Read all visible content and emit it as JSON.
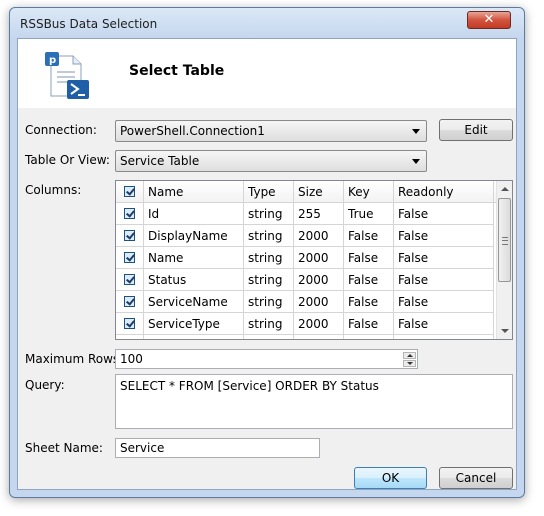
{
  "window": {
    "title": "RSSBus Data Selection",
    "close_glyph": "✕"
  },
  "header": {
    "title": "Select Table",
    "icon": "powershell-document-icon"
  },
  "connection": {
    "label": "Connection:",
    "value": "PowerShell.Connection1",
    "edit_label": "Edit"
  },
  "table": {
    "label": "Table Or View:",
    "value": "Service Table"
  },
  "columns": {
    "label": "Columns:",
    "headers": [
      "Name",
      "Type",
      "Size",
      "Key",
      "Readonly"
    ],
    "rows": [
      {
        "checked": true,
        "name": "Id",
        "type": "string",
        "size": "255",
        "key": "True",
        "readonly": "False"
      },
      {
        "checked": true,
        "name": "DisplayName",
        "type": "string",
        "size": "2000",
        "key": "False",
        "readonly": "False"
      },
      {
        "checked": true,
        "name": "Name",
        "type": "string",
        "size": "2000",
        "key": "False",
        "readonly": "False"
      },
      {
        "checked": true,
        "name": "Status",
        "type": "string",
        "size": "2000",
        "key": "False",
        "readonly": "False"
      },
      {
        "checked": true,
        "name": "ServiceName",
        "type": "string",
        "size": "2000",
        "key": "False",
        "readonly": "False"
      },
      {
        "checked": true,
        "name": "ServiceType",
        "type": "string",
        "size": "2000",
        "key": "False",
        "readonly": "False"
      }
    ]
  },
  "max_rows": {
    "label": "Maximum Rows:",
    "value": "100"
  },
  "query": {
    "label": "Query:",
    "value": "SELECT  *  FROM [Service] ORDER BY Status"
  },
  "sheet": {
    "label": "Sheet Name:",
    "value": "Service"
  },
  "buttons": {
    "ok": "OK",
    "cancel": "Cancel"
  }
}
